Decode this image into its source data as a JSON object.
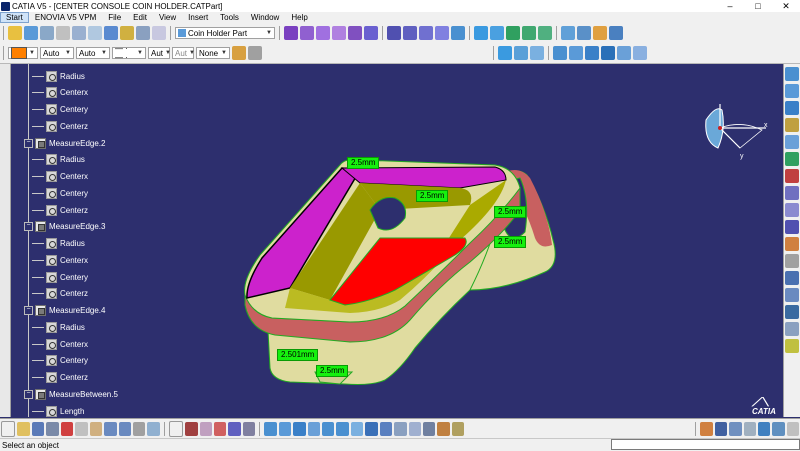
{
  "window": {
    "title": "CATIA V5 - [CENTER CONSOLE COIN HOLDER.CATPart]",
    "minimize": "–",
    "maximize": "□",
    "close": "✕"
  },
  "menu": {
    "items": [
      "Start",
      "ENOVIA V5 VPM",
      "File",
      "Edit",
      "View",
      "Insert",
      "Tools",
      "Window",
      "Help"
    ]
  },
  "toolbar1": {
    "part_selector": "Coin Holder Part"
  },
  "toolbar2": {
    "linetype": "Auto",
    "thickness": "Auto",
    "dash": "— · — ·",
    "aut1": "Aut",
    "aut2": "Aut",
    "layer": "None"
  },
  "tree": {
    "nodes": [
      {
        "label": "Radius",
        "kind": "leaf"
      },
      {
        "label": "Centerx",
        "kind": "leaf"
      },
      {
        "label": "Centery",
        "kind": "leaf"
      },
      {
        "label": "Centerz",
        "kind": "leaf"
      },
      {
        "label": "MeasureEdge.2",
        "kind": "group"
      },
      {
        "label": "Radius",
        "kind": "leaf"
      },
      {
        "label": "Centerx",
        "kind": "leaf"
      },
      {
        "label": "Centery",
        "kind": "leaf"
      },
      {
        "label": "Centerz",
        "kind": "leaf"
      },
      {
        "label": "MeasureEdge.3",
        "kind": "group"
      },
      {
        "label": "Radius",
        "kind": "leaf"
      },
      {
        "label": "Centerx",
        "kind": "leaf"
      },
      {
        "label": "Centery",
        "kind": "leaf"
      },
      {
        "label": "Centerz",
        "kind": "leaf"
      },
      {
        "label": "MeasureEdge.4",
        "kind": "group"
      },
      {
        "label": "Radius",
        "kind": "leaf"
      },
      {
        "label": "Centerx",
        "kind": "leaf"
      },
      {
        "label": "Centery",
        "kind": "leaf"
      },
      {
        "label": "Centerz",
        "kind": "leaf"
      },
      {
        "label": "MeasureBetween.5",
        "kind": "group"
      },
      {
        "label": "Length",
        "kind": "leaf"
      }
    ]
  },
  "dimensions": [
    "2.5mm",
    "2.5mm",
    "2.5mm",
    "2.5mm",
    "2.501mm",
    "2.5mm"
  ],
  "compass": {
    "x_label": "x",
    "y_label": "y"
  },
  "logo": {
    "text": "CATIA"
  },
  "status": {
    "message": "Select an object"
  },
  "colors": {
    "viewport_bg": "#2d2f6e",
    "dim_label": "#16f00e",
    "rim": "#cc22cc",
    "floor": "#ff0000",
    "wall": "#999900",
    "body": "#e0dca0",
    "band": "#c86060"
  }
}
